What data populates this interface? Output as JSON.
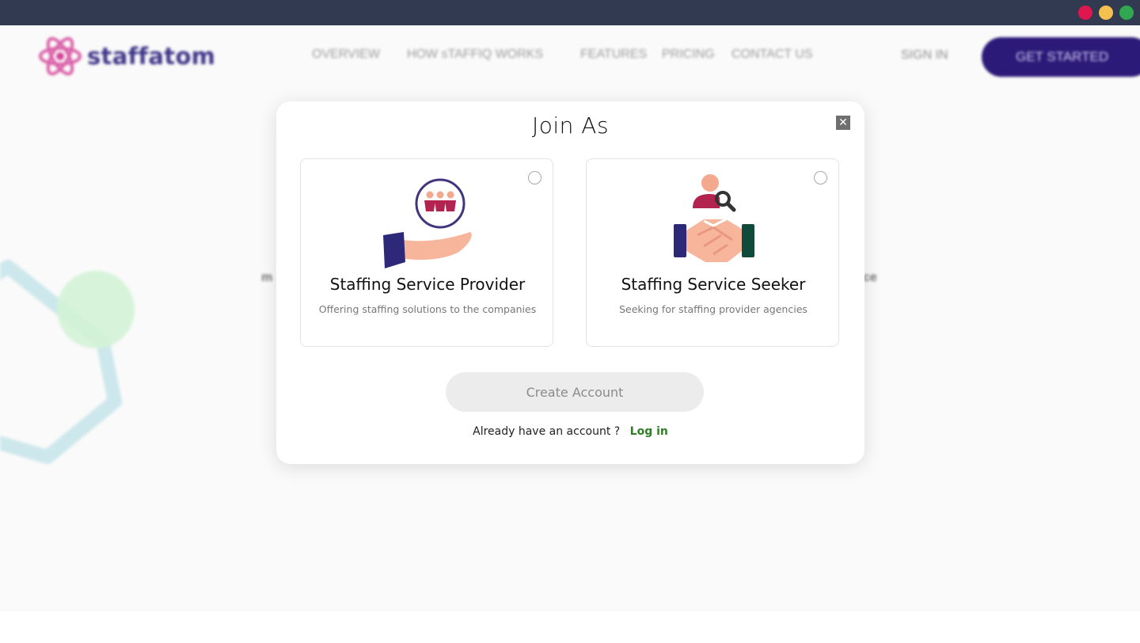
{
  "window": {
    "controls": [
      {
        "name": "close",
        "color": "#e0174f"
      },
      {
        "name": "minimize",
        "color": "#f5c04e"
      },
      {
        "name": "maximize",
        "color": "#2fa84f"
      }
    ]
  },
  "header": {
    "logo_text": "staffatom",
    "nav": [
      "OVERVIEW",
      "HOW sTAFFIQ WORKS",
      "FEATURES",
      "PRICING",
      "CONTACT US"
    ],
    "sign_in": "SIGN IN",
    "get_started": "GET STARTED"
  },
  "background": {
    "text_left": "m",
    "text_right": "ce"
  },
  "modal": {
    "title": "Join As",
    "close_icon": "close-icon",
    "options": [
      {
        "title": "Staffing Service Provider",
        "subtitle": "Offering staffing solutions to the companies",
        "icon": "hand-holding-people-icon",
        "selected": false
      },
      {
        "title": "Staffing Service Seeker",
        "subtitle": "Seeking for staffing provider agencies",
        "icon": "handshake-search-icon",
        "selected": false
      }
    ],
    "create_account": "Create Account",
    "already_text": "Already have an account ?",
    "login_link": "Log in"
  },
  "colors": {
    "brand_purple": "#2c1a78",
    "login_green": "#2d7f23",
    "chrome_bar": "#323a52"
  }
}
